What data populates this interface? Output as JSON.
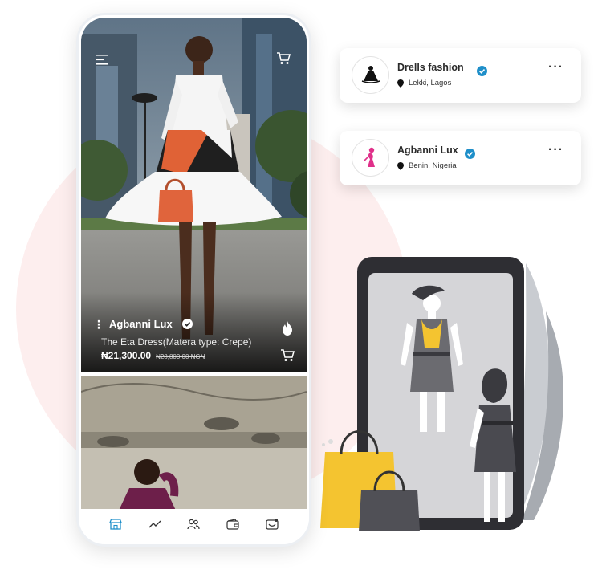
{
  "feed": {
    "vendor_name": "Agbanni Lux",
    "product_name": "The Eta Dress(Matera type: Crepe)",
    "price_current": "₦21,300.00",
    "price_original": "₦28,800.00 NGN"
  },
  "vendors": [
    {
      "name": "Drells fashion",
      "location": "Lekki, Lagos",
      "logo_text": "Drells fashion"
    },
    {
      "name": "Agbanni Lux",
      "location": "Benin, Nigeria"
    }
  ],
  "bottom_nav": [
    "store-icon",
    "trending-icon",
    "people-icon",
    "wallet-icon",
    "inbox-icon"
  ],
  "colors": {
    "accent": "#1f8fc9",
    "badge_blue": "#1f8fc9",
    "brand_pink": "#e0308a",
    "bag_yellow": "#f4c430",
    "bg_pink": "#fdeeee"
  }
}
